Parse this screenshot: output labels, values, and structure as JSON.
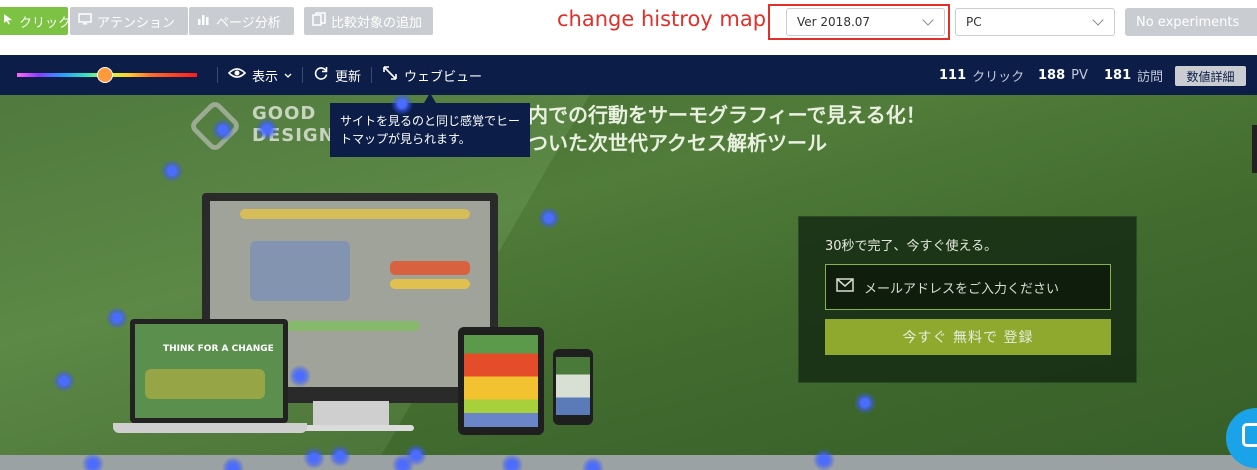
{
  "header": {
    "tabs": [
      {
        "label": "クリック",
        "icon": "cursor-click-icon",
        "active": true
      },
      {
        "label": "アテンション",
        "icon": "monitor-icon",
        "active": false
      },
      {
        "label": "ページ分析",
        "icon": "bar-chart-icon",
        "active": false
      }
    ],
    "compare_button": {
      "label": "比較対象の追加",
      "icon": "copy-icon"
    },
    "annotation": "change histroy map",
    "version_select": {
      "value": "Ver 2018.07"
    },
    "device_select": {
      "value": "PC"
    },
    "experiments_select": {
      "value": "No experiments"
    }
  },
  "toolbar": {
    "display_label": "表示",
    "refresh_label": "更新",
    "webview_label": "ウェブビュー",
    "stats": {
      "clicks_value": "111",
      "clicks_unit": "クリック",
      "pv_value": "188",
      "pv_unit": "PV",
      "visits_value": "181",
      "visits_unit": "訪問"
    },
    "detail_button": "数値詳細",
    "colors": {
      "toolbar_bg": "#0c1e48",
      "active_tab": "#7cc243",
      "annotation": "#e0302a"
    }
  },
  "tooltip": {
    "line1": "サイトを見るのと同じ感覚でヒー",
    "line2": "トマップが見られます。"
  },
  "page": {
    "logo_line1": "GOOD",
    "logo_line2": "DESIGN",
    "headline_line1": "内での行動をサーモグラフィーで見える化！",
    "headline_line2": "ついた次世代アクセス解析ツール",
    "laptop_text": "THINK FOR A CHANGE",
    "signup": {
      "title": "30秒で完了、今すぐ使える。",
      "email_placeholder": "メールアドレスをご入力ください",
      "submit_label": "今すぐ 無料で 登録"
    }
  }
}
